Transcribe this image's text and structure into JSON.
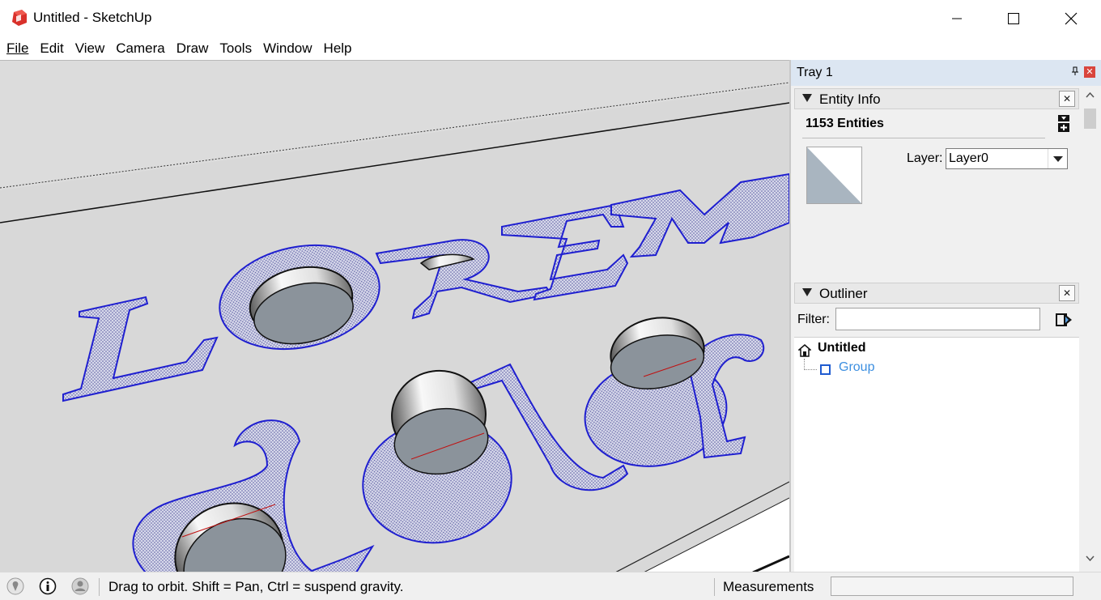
{
  "window": {
    "title": "Untitled - SketchUp",
    "icon": "sketchup-icon",
    "controls": [
      "minimize-icon",
      "maximize-icon",
      "close-icon"
    ]
  },
  "menu": [
    "File",
    "Edit",
    "View",
    "Camera",
    "Draw",
    "Tools",
    "Window",
    "Help"
  ],
  "viewport": {
    "model_text_line1": "LOREM",
    "model_text_line2": "dolor",
    "selection_color": "#1f1fd0",
    "surface_color": "#d8d8d8"
  },
  "tray": {
    "title": "Tray 1",
    "entity_info": {
      "title": "Entity Info",
      "entities": "1153 Entities",
      "layer_label": "Layer:",
      "layer_value": "Layer0"
    },
    "outliner": {
      "title": "Outliner",
      "filter_label": "Filter:",
      "filter_value": "",
      "root": "Untitled",
      "children": [
        "Group"
      ]
    }
  },
  "status": {
    "hint": "Drag to orbit. Shift = Pan, Ctrl = suspend gravity.",
    "measurements_label": "Measurements",
    "measurements_value": "",
    "icons": [
      "geo-location-icon",
      "credits-icon",
      "user-icon"
    ]
  },
  "colors": {
    "tray_header": "#dce6f2",
    "link_blue": "#3d8fe0",
    "sketchup_red": "#d9312b"
  }
}
